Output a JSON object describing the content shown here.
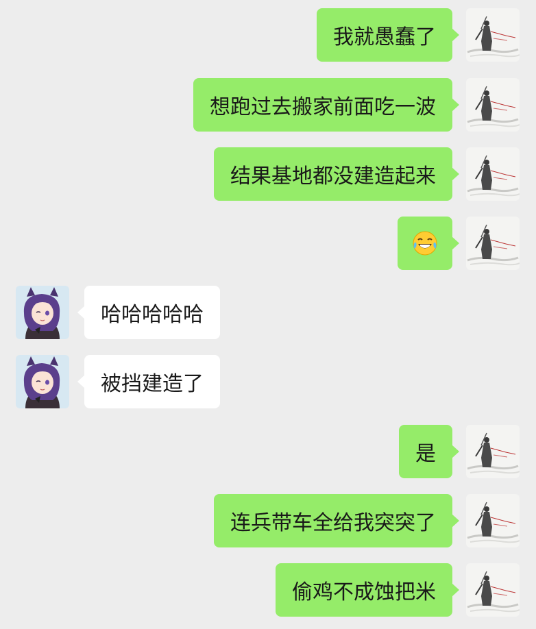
{
  "colors": {
    "background": "#ededed",
    "my_bubble": "#95ec69",
    "their_bubble": "#ffffff",
    "text": "#191919"
  },
  "messages": [
    {
      "sender": "me",
      "text": "我就愚蠢了"
    },
    {
      "sender": "me",
      "text": "想跑过去搬家前面吃一波"
    },
    {
      "sender": "me",
      "text": "结果基地都没建造起来"
    },
    {
      "sender": "me",
      "text": "",
      "icon": "tears-of-joy-emoji-icon"
    },
    {
      "sender": "other",
      "text": "哈哈哈哈哈"
    },
    {
      "sender": "other",
      "text": "被挡建造了"
    },
    {
      "sender": "me",
      "text": "是"
    },
    {
      "sender": "me",
      "text": "连兵带车全给我突突了"
    },
    {
      "sender": "me",
      "text": "偷鸡不成蚀把米"
    }
  ],
  "avatars": {
    "me": "ink-painting-swordsman-avatar",
    "other": "purple-haired-anime-girl-avatar"
  }
}
